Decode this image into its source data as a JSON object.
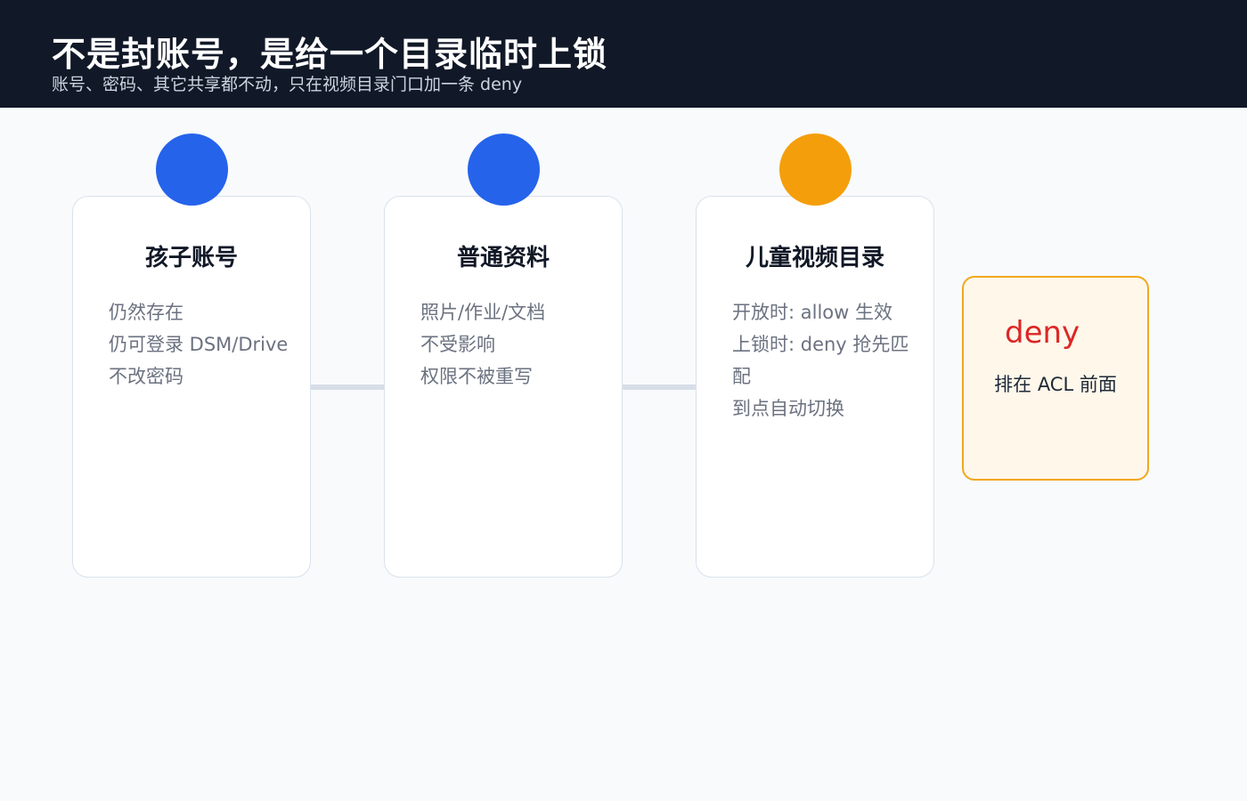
{
  "header": {
    "title": "不是封账号，是给一个目录临时上锁",
    "subtitle": "账号、密码、其它共享都不动，只在视频目录门口加一条 deny"
  },
  "colors": {
    "header_bg": "#111827",
    "blue": "#2563eb",
    "orange": "#f59e0b",
    "deny_red": "#dc2626",
    "note_border": "#f1a81e",
    "note_bg": "#fef7ea"
  },
  "cards": [
    {
      "title": "孩子账号",
      "lines": [
        "仍然存在",
        "仍可登录 DSM/Drive",
        "不改密码"
      ]
    },
    {
      "title": "普通资料",
      "lines": [
        "照片/作业/文档",
        "不受影响",
        "权限不被重写"
      ]
    },
    {
      "title": "儿童视频目录",
      "lines": [
        "开放时: allow 生效",
        "上锁时: deny 抢先匹配",
        "到点自动切换"
      ]
    }
  ],
  "note": {
    "label": "deny",
    "text": "排在 ACL 前面"
  }
}
